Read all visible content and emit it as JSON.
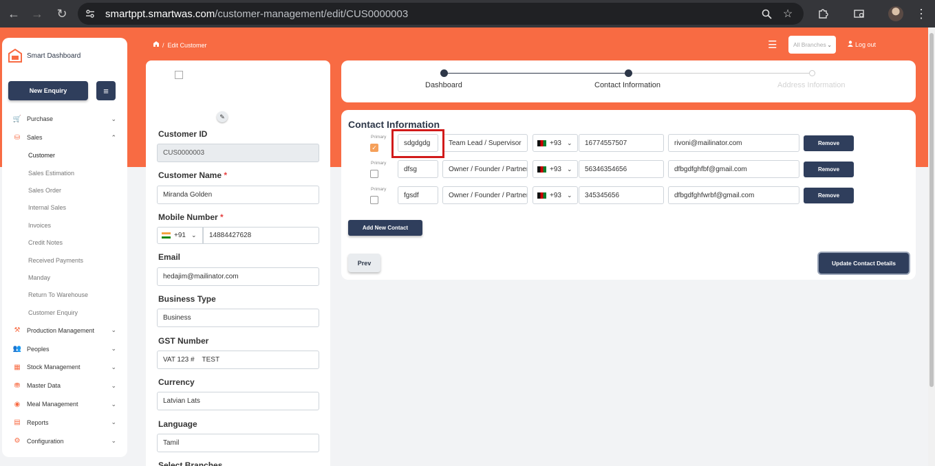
{
  "browser": {
    "url_host": "smartppt.smartwas.com",
    "url_path": "/customer-management/edit/CUS0000003"
  },
  "sidebar": {
    "brand": "Smart Dashboard",
    "new_enquiry": "New Enquiry",
    "items": [
      {
        "label": "Purchase",
        "icon": "cart-icon"
      },
      {
        "label": "Sales",
        "icon": "sales-icon"
      },
      {
        "label": "Production Management",
        "icon": "factory-icon"
      },
      {
        "label": "Peoples",
        "icon": "people-icon"
      },
      {
        "label": "Stock Management",
        "icon": "stock-icon"
      },
      {
        "label": "Master Data",
        "icon": "database-icon"
      },
      {
        "label": "Meal Management",
        "icon": "meal-icon"
      },
      {
        "label": "Reports",
        "icon": "report-icon"
      },
      {
        "label": "Configuration",
        "icon": "config-icon"
      }
    ],
    "sales_sub": [
      "Customer",
      "Sales Estimation",
      "Sales Order",
      "Internal Sales",
      "Invoices",
      "Credit Notes",
      "Received Payments",
      "Manday",
      "Return To Warehouse",
      "Customer Enquiry"
    ]
  },
  "header": {
    "breadcrumb": "Edit Customer",
    "branch_placeholder": "All Branches",
    "logout": "Log out"
  },
  "customer": {
    "id_label": "Customer ID",
    "id_value": "CUS0000003",
    "name_label": "Customer Name",
    "name_value": "Miranda Golden",
    "mobile_label": "Mobile Number",
    "mobile_cc": "+91",
    "mobile_value": "14884427628",
    "email_label": "Email",
    "email_value": "hedajim@mailinator.com",
    "btype_label": "Business Type",
    "btype_value": "Business",
    "gst_label": "GST Number",
    "gst_value": "VAT 123 #    TEST",
    "currency_label": "Currency",
    "currency_value": "Latvian Lats",
    "language_label": "Language",
    "language_value": "Tamil",
    "branches_label": "Select Branches"
  },
  "stepper": {
    "steps": [
      "Dashboard",
      "Contact Information",
      "Address Information"
    ]
  },
  "contact": {
    "title": "Contact Information",
    "primary_label": "Primary",
    "remove_label": "Remove",
    "add_label": "Add New Contact",
    "prev_label": "Prev",
    "update_label": "Update Contact Details",
    "rows": [
      {
        "primary": true,
        "name": "sdgdgdg",
        "role": "Team Lead / Supervisor",
        "cc": "+93",
        "phone": "16774557507",
        "email": "rivoni@mailinator.com"
      },
      {
        "primary": false,
        "name": "dfsg",
        "role": "Owner / Founder / Partner",
        "cc": "+93",
        "phone": "56346354656",
        "email": "dfbgdfghfbf@gmail.com"
      },
      {
        "primary": false,
        "name": "fgsdf",
        "role": "Owner / Founder / Partner",
        "cc": "+93",
        "phone": "345345656",
        "email": "dfbgdfghfwrbf@gmail.com"
      }
    ]
  }
}
